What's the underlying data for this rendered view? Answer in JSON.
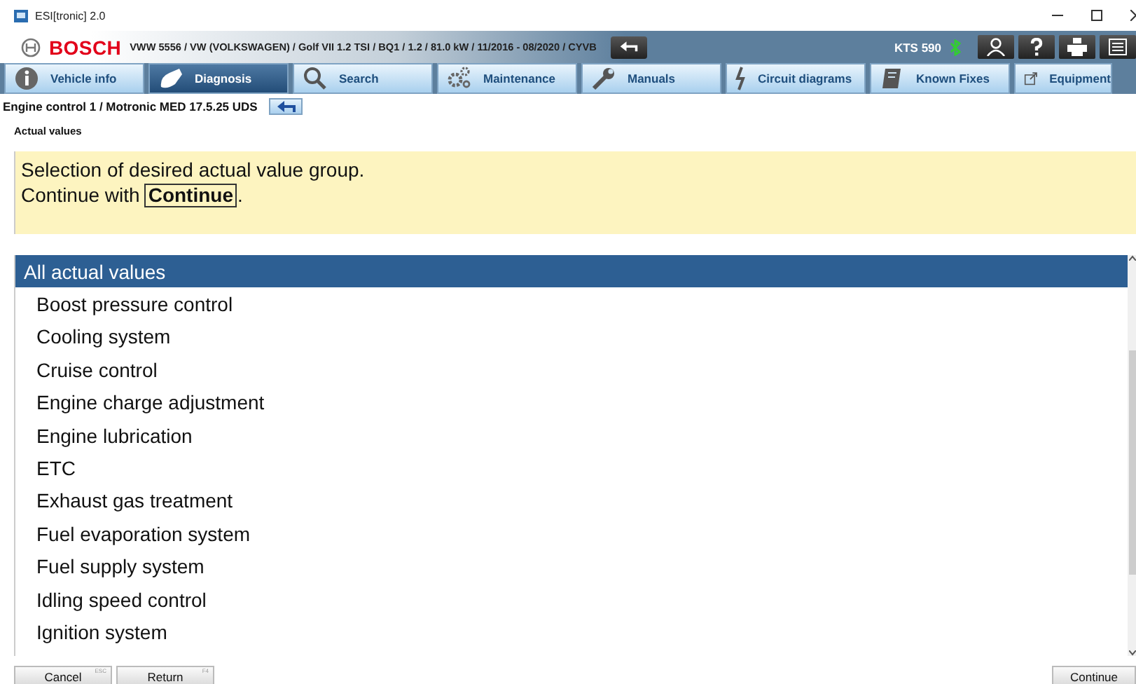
{
  "window": {
    "title": "ESI[tronic] 2.0"
  },
  "header": {
    "brand": "BOSCH",
    "vehicle": "VWW 5556 / VW (VOLKSWAGEN) / Golf VII 1.2 TSI / BQ1 / 1.2 / 81.0 kW / 11/2016 - 08/2020 / CYVB",
    "device": "KTS 590"
  },
  "tabs": [
    {
      "label": "Vehicle info",
      "selected": false
    },
    {
      "label": "Diagnosis",
      "selected": true
    },
    {
      "label": "Search",
      "selected": false
    },
    {
      "label": "Maintenance",
      "selected": false
    },
    {
      "label": "Manuals",
      "selected": false
    },
    {
      "label": "Circuit diagrams",
      "selected": false
    },
    {
      "label": "Known Fixes",
      "selected": false
    },
    {
      "label": "Equipment",
      "selected": false
    }
  ],
  "breadcrumb": "Engine control 1 / Motronic MED 17.5.25 UDS",
  "section_title": "Actual values",
  "info": {
    "line1": "Selection of desired actual value group.",
    "line2_prefix": "Continue with",
    "line2_button": "Continue",
    "line2_suffix": "."
  },
  "list": [
    {
      "label": "All actual values",
      "selected": true
    },
    {
      "label": "Boost pressure control",
      "selected": false
    },
    {
      "label": "Cooling system",
      "selected": false
    },
    {
      "label": "Cruise control",
      "selected": false
    },
    {
      "label": "Engine charge adjustment",
      "selected": false
    },
    {
      "label": "Engine lubrication",
      "selected": false
    },
    {
      "label": "ETC",
      "selected": false
    },
    {
      "label": "Exhaust gas treatment",
      "selected": false
    },
    {
      "label": "Fuel evaporation system",
      "selected": false
    },
    {
      "label": "Fuel supply system",
      "selected": false
    },
    {
      "label": "Idling speed control",
      "selected": false
    },
    {
      "label": "Ignition system",
      "selected": false
    }
  ],
  "buttons": [
    {
      "label": "Cancel",
      "key": "ESC"
    },
    {
      "label": "Return",
      "key": "F4"
    },
    {
      "label": "Continue"
    }
  ]
}
